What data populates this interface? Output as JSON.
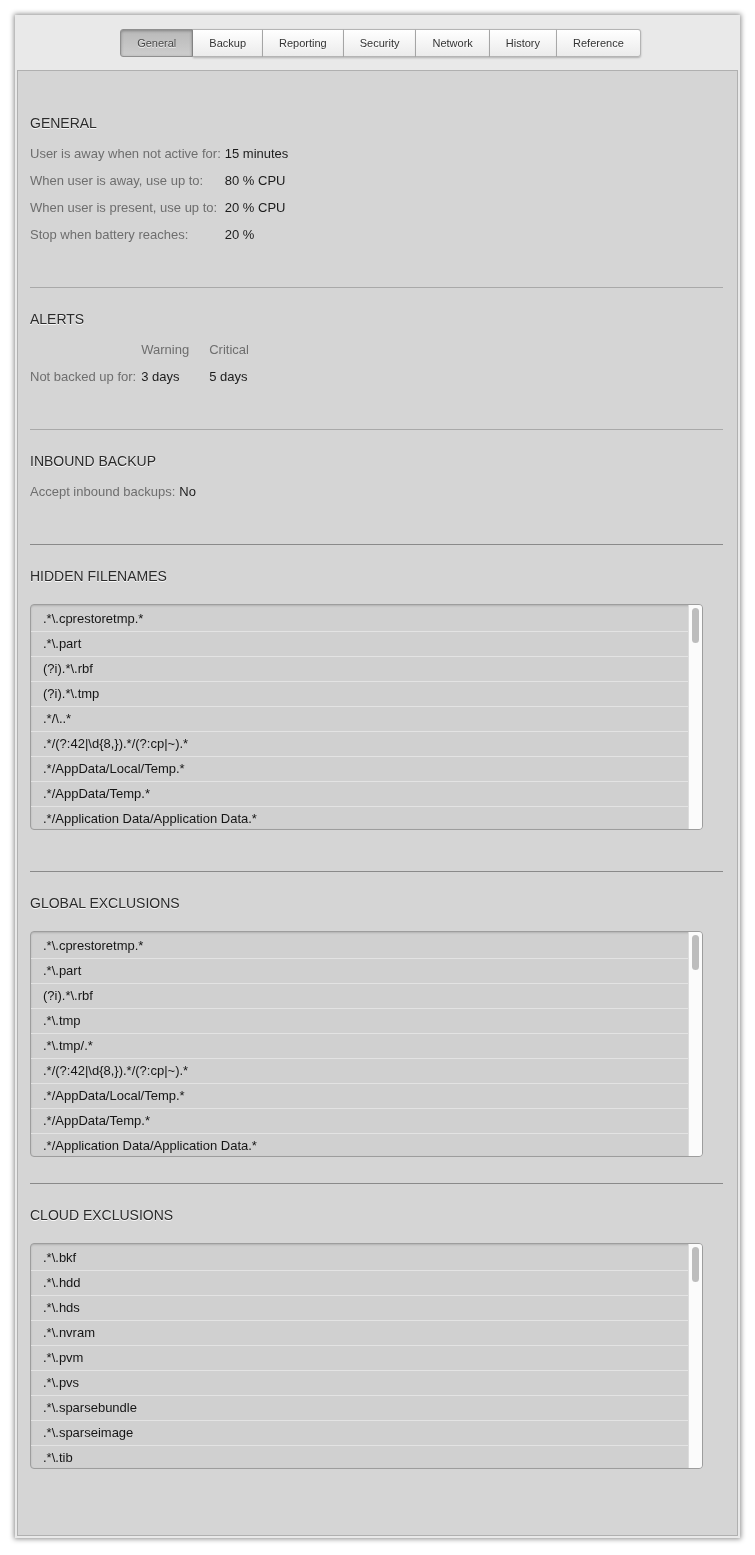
{
  "tabs": [
    {
      "label": "General",
      "selected": true
    },
    {
      "label": "Backup",
      "selected": false
    },
    {
      "label": "Reporting",
      "selected": false
    },
    {
      "label": "Security",
      "selected": false
    },
    {
      "label": "Network",
      "selected": false
    },
    {
      "label": "History",
      "selected": false
    },
    {
      "label": "Reference",
      "selected": false
    }
  ],
  "sections": [
    {
      "kind": "fields",
      "title": "GENERAL",
      "rows": [
        {
          "label": "User is away when not active for:",
          "value": "15 minutes"
        },
        {
          "label": "When user is away, use up to:",
          "value": "80 % CPU"
        },
        {
          "label": "When user is present, use up to:",
          "value": "20 % CPU"
        },
        {
          "label": "Stop when battery reaches:",
          "value": "20 %"
        }
      ]
    },
    {
      "kind": "table",
      "title": "ALERTS",
      "columns": [
        "Warning",
        "Critical"
      ],
      "rows": [
        {
          "label": "Not backed up for:",
          "values": [
            "3 days",
            "5 days"
          ]
        }
      ]
    },
    {
      "kind": "fields",
      "title": "INBOUND BACKUP",
      "rows": [
        {
          "label": "Accept inbound backups:",
          "value": "No"
        }
      ]
    },
    {
      "kind": "list",
      "title": "HIDDEN FILENAMES",
      "items": [
        ".*\\.cprestoretmp.*",
        ".*\\.part",
        "(?i).*\\.rbf",
        "(?i).*\\.tmp",
        ".*/\\..*",
        ".*/(?:42|\\d{8,}).*/(?:cp|~).*",
        ".*/AppData/Local/Temp.*",
        ".*/AppData/Temp.*",
        ".*/Application Data/Application Data.*"
      ]
    },
    {
      "kind": "list",
      "title": "GLOBAL EXCLUSIONS",
      "items": [
        ".*\\.cprestoretmp.*",
        ".*\\.part",
        "(?i).*\\.rbf",
        ".*\\.tmp",
        ".*\\.tmp/.*",
        ".*/(?:42|\\d{8,}).*/(?:cp|~).*",
        ".*/AppData/Local/Temp.*",
        ".*/AppData/Temp.*",
        ".*/Application Data/Application Data.*"
      ]
    },
    {
      "kind": "list",
      "title": "CLOUD EXCLUSIONS",
      "items": [
        ".*\\.bkf",
        ".*\\.hdd",
        ".*\\.hds",
        ".*\\.nvram",
        ".*\\.pvm",
        ".*\\.pvs",
        ".*\\.sparsebundle",
        ".*\\.sparseimage",
        ".*\\.tib"
      ]
    }
  ]
}
